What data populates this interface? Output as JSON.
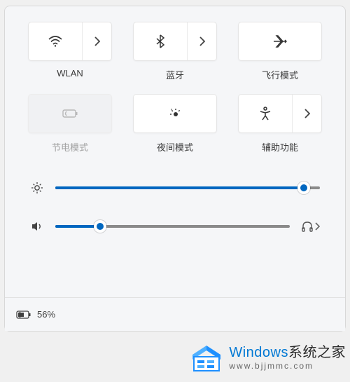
{
  "tiles": {
    "wlan": {
      "label": "WLAN",
      "expandable": true
    },
    "bluetooth": {
      "label": "蓝牙",
      "expandable": true
    },
    "airplane": {
      "label": "飞行模式",
      "expandable": false
    },
    "battery_saver": {
      "label": "节电模式",
      "disabled": true
    },
    "night": {
      "label": "夜间模式"
    },
    "accessibility": {
      "label": "辅助功能",
      "expandable": true
    }
  },
  "sliders": {
    "brightness": {
      "value": 94
    },
    "volume": {
      "value": 19
    }
  },
  "status": {
    "battery_percent": "56%"
  },
  "watermark": {
    "line1_brand": "Windows",
    "line1_rest": "系统之家",
    "line2": "www.bjjmmc.com"
  },
  "colors": {
    "accent": "#0067c0"
  }
}
